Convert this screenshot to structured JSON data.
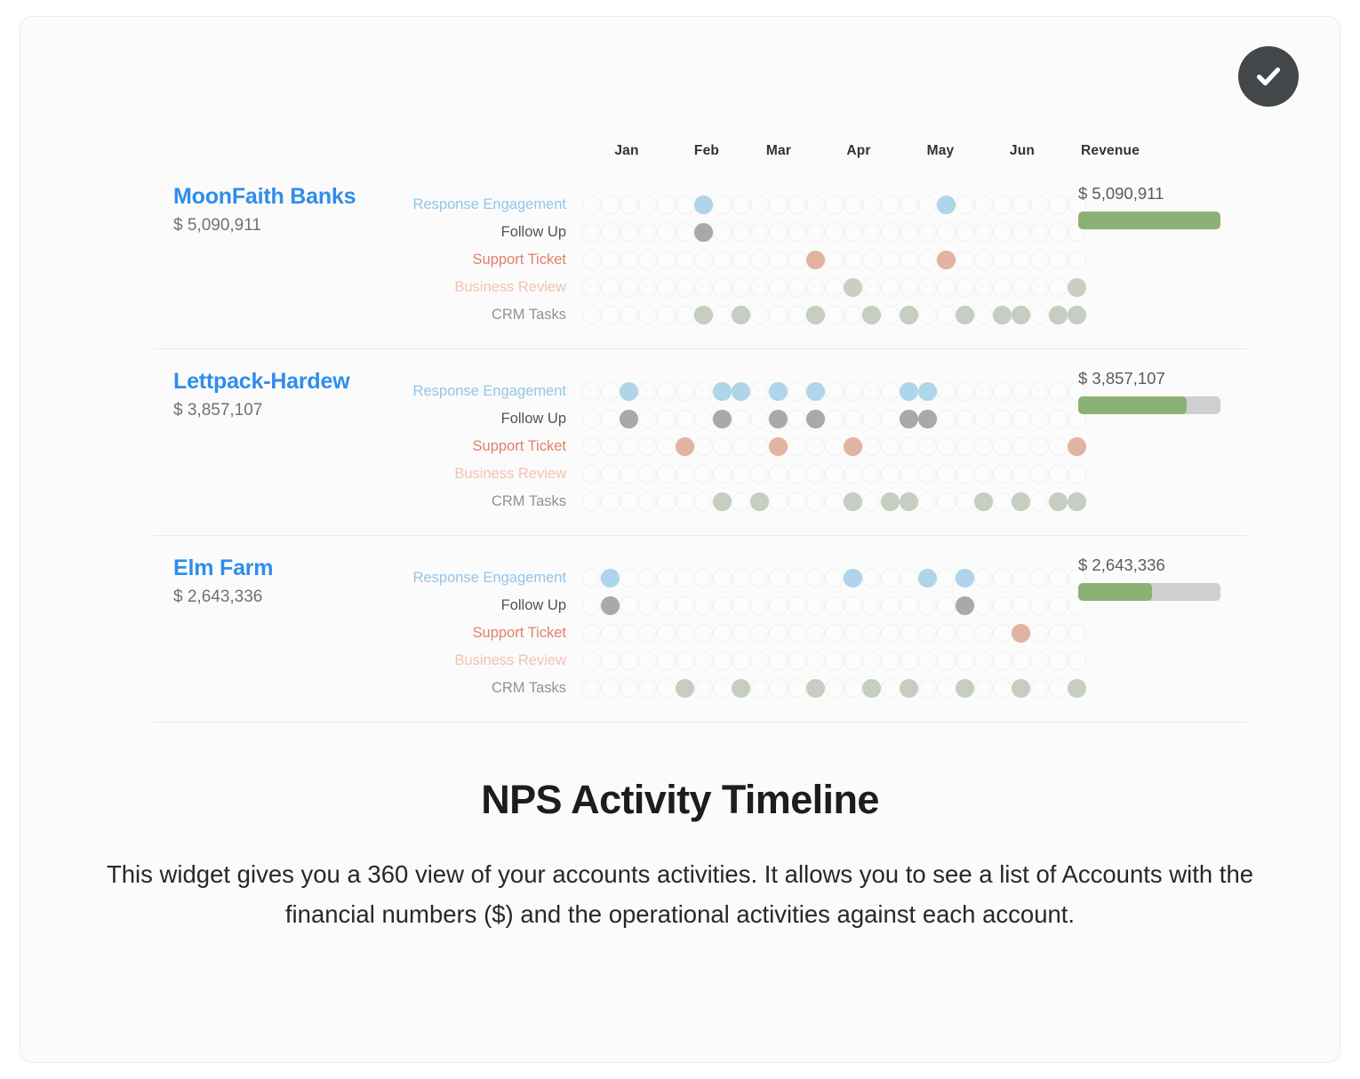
{
  "badge": {
    "icon": "check-circle-icon",
    "color": "#43474a"
  },
  "header": {
    "months": [
      "Jan",
      "Feb",
      "Mar",
      "Apr",
      "May",
      "Jun"
    ],
    "revenue_label": "Revenue"
  },
  "track_labels": {
    "response": "Response Engagement",
    "follow": "Follow Up",
    "support": "Support Ticket",
    "review": "Business Review",
    "crm": "CRM Tasks"
  },
  "colors": {
    "account_name": "#2f8ded",
    "response": "#93c5e8",
    "response_dot": "#aed5ea",
    "follow": "#4f5358",
    "follow_dot": "#a9a9a9",
    "support": "#e0806a",
    "support_dot": "#e0b4a1",
    "review": "#f0c3b2",
    "review_dot": "#c9cfc4",
    "crm": "#8f9499",
    "crm_dot": "#c6cdc1",
    "bar_fill": "#8cb273",
    "bar_track": "#cfcfcf"
  },
  "grid": {
    "columns": 27
  },
  "accounts": [
    {
      "name": "MoonFaith Banks",
      "revenue_text": "$ 5,090,911",
      "revenue_value": 5090911,
      "revenue_amount_right": "$ 5,090,911",
      "bar_percent": 100,
      "tracks": {
        "response": [
          6,
          19
        ],
        "follow": [
          6
        ],
        "support": [
          12,
          19
        ],
        "review": [
          14,
          26
        ],
        "crm": [
          6,
          8,
          12,
          15,
          17,
          20,
          22,
          23,
          25,
          26
        ]
      }
    },
    {
      "name": "Lettpack-Hardew",
      "revenue_text": "$ 3,857,107",
      "revenue_value": 3857107,
      "revenue_amount_right": "$ 3,857,107",
      "bar_percent": 76,
      "tracks": {
        "response": [
          2,
          7,
          8,
          10,
          12,
          17,
          18
        ],
        "follow": [
          2,
          7,
          10,
          12,
          17,
          18
        ],
        "support": [
          5,
          10,
          14,
          26
        ],
        "review": [],
        "crm": [
          7,
          9,
          14,
          16,
          17,
          21,
          23,
          25,
          26
        ]
      }
    },
    {
      "name": "Elm Farm",
      "revenue_text": "$ 2,643,336",
      "revenue_value": 2643336,
      "revenue_amount_right": "$ 2,643,336",
      "bar_percent": 52,
      "tracks": {
        "response": [
          1,
          14,
          18,
          20
        ],
        "follow": [
          1,
          20
        ],
        "support": [
          23
        ],
        "review": [],
        "crm": [
          5,
          8,
          12,
          15,
          17,
          20,
          23,
          26
        ]
      }
    }
  ],
  "caption": {
    "title": "NPS Activity Timeline",
    "body": "This widget gives you a 360 view of your accounts activities. It allows you to see a list of Accounts with the financial numbers ($) and the operational activities against each account."
  }
}
